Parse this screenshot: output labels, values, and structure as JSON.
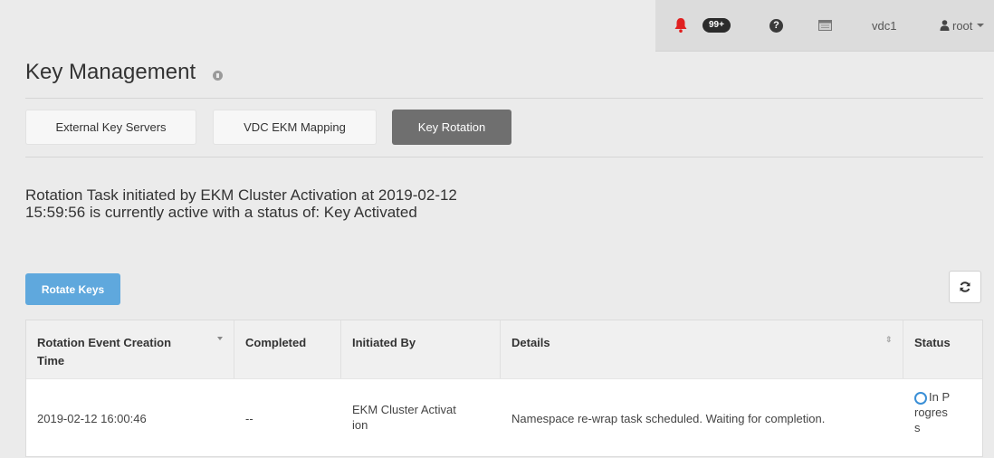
{
  "header": {
    "notifications_count": "99+",
    "vdc_label": "vdc1",
    "user_label": "root"
  },
  "page": {
    "title": "Key Management"
  },
  "tabs": [
    {
      "label": "External Key Servers",
      "active": false
    },
    {
      "label": "VDC EKM Mapping",
      "active": false
    },
    {
      "label": "Key Rotation",
      "active": true
    }
  ],
  "status_message_line1": "Rotation Task initiated by EKM Cluster Activation at 2019-02-12",
  "status_message_line2": "15:59:56 is currently active with a status of: Key Activated",
  "actions": {
    "rotate_keys_label": "Rotate Keys"
  },
  "table": {
    "headers": {
      "time_line1": "Rotation Event Creation",
      "time_line2": "Time",
      "completed": "Completed",
      "initiated_by": "Initiated By",
      "details": "Details",
      "status": "Status"
    },
    "rows": [
      {
        "time": "2019-02-12 16:00:46",
        "completed": "--",
        "initiated_line1": "EKM Cluster Activat",
        "initiated_line2": "ion",
        "details": "Namespace re-wrap task scheduled. Waiting for completion.",
        "status_line1": "In P",
        "status_line2": "rogres",
        "status_line3": "s"
      }
    ]
  },
  "colors": {
    "accent_blue": "#5fa8dd",
    "active_tab": "#6f6f6f",
    "bell_red": "#e02020"
  },
  "icons": [
    "bell-icon",
    "help-icon",
    "console-icon",
    "user-icon",
    "caret-down-icon",
    "info-icon",
    "refresh-icon",
    "sort-desc-icon",
    "sort-icon",
    "in-progress-icon"
  ]
}
